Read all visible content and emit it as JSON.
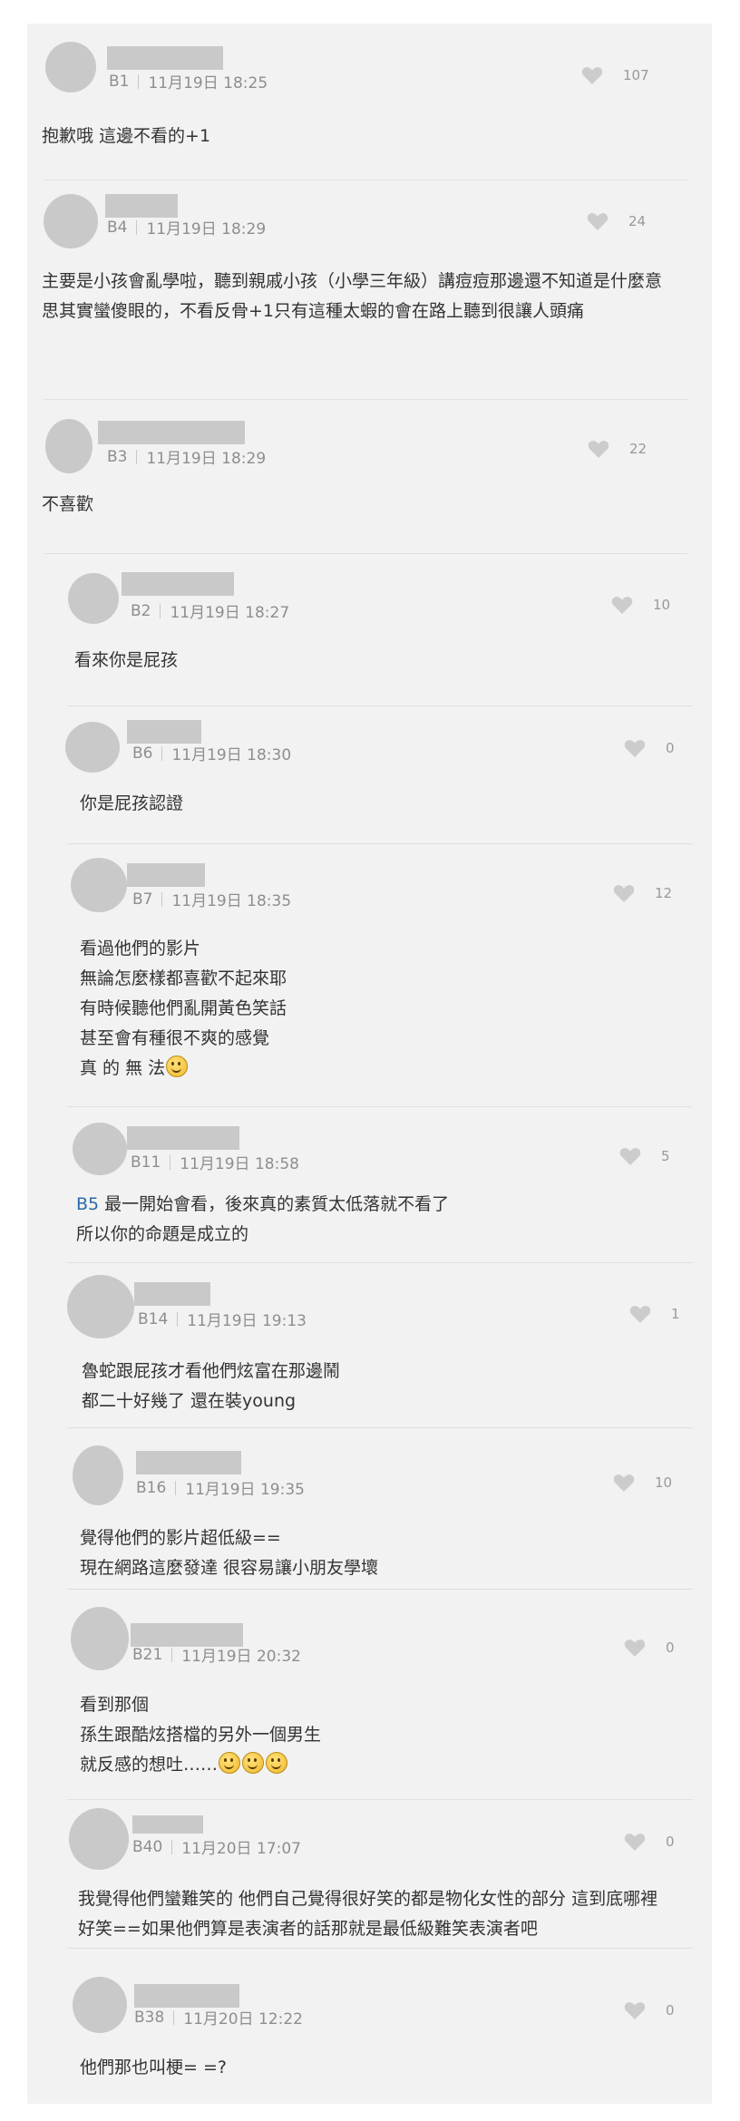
{
  "comments": [
    {
      "floor": "B1",
      "time": "11月19日 18:25",
      "likes": "107",
      "lines": [
        "抱歉哦 這邊不看的+1"
      ]
    },
    {
      "floor": "B4",
      "time": "11月19日 18:29",
      "likes": "24",
      "text": "主要是小孩會亂學啦，聽到親戚小孩（小學三年級）講痘痘那邊還不知道是什麼意思其實蠻傻眼的，不看反骨+1只有這種太蝦的會在路上聽到很讓人頭痛"
    },
    {
      "floor": "B3",
      "time": "11月19日 18:29",
      "likes": "22",
      "lines": [
        "不喜歡"
      ]
    },
    {
      "floor": "B2",
      "time": "11月19日 18:27",
      "likes": "10",
      "lines": [
        "看來你是屁孩"
      ]
    },
    {
      "floor": "B6",
      "time": "11月19日 18:30",
      "likes": "0",
      "lines": [
        "你是屁孩認證"
      ]
    },
    {
      "floor": "B7",
      "time": "11月19日 18:35",
      "likes": "12",
      "lines": [
        "看過他們的影片",
        "無論怎麼樣都喜歡不起來耶",
        "有時候聽他們亂開黃色笑話",
        "甚至會有種很不爽的感覺",
        "真 的 無 法"
      ]
    },
    {
      "floor": "B11",
      "time": "11月19日 18:58",
      "likes": "5",
      "quote": "B5",
      "lines": [
        " 最一開始會看，後來真的素質太低落就不看了",
        "所以你的命題是成立的"
      ]
    },
    {
      "floor": "B14",
      "time": "11月19日 19:13",
      "likes": "1",
      "lines": [
        "魯蛇跟屁孩才看他們炫富在那邊鬧",
        "都二十好幾了 還在裝young"
      ]
    },
    {
      "floor": "B16",
      "time": "11月19日 19:35",
      "likes": "10",
      "lines": [
        "覺得他們的影片超低級==",
        "現在網路這麼發達 很容易讓小朋友學壞"
      ]
    },
    {
      "floor": "B21",
      "time": "11月19日 20:32",
      "likes": "0",
      "lines": [
        "看到那個",
        "孫生跟酷炫搭檔的另外一個男生",
        "就反感的想吐……"
      ]
    },
    {
      "floor": "B40",
      "time": "11月20日 17:07",
      "likes": "0",
      "text": "我覺得他們蠻難笑的 他們自己覺得很好笑的都是物化女性的部分 這到底哪裡好笑==如果他們算是表演者的話那就是最低級難笑表演者吧"
    },
    {
      "floor": "B38",
      "time": "11月20日 12:22",
      "likes": "0",
      "lines": [
        "他們那也叫梗= =?"
      ]
    }
  ],
  "icons": {
    "like": "heart-icon",
    "emoji": "smiley-emoji-icon"
  },
  "colors": {
    "panel": "#f2f2f2",
    "avatar": "#c9c9c9",
    "meta": "#8e8e8e",
    "quote": "#2a6aa8"
  }
}
